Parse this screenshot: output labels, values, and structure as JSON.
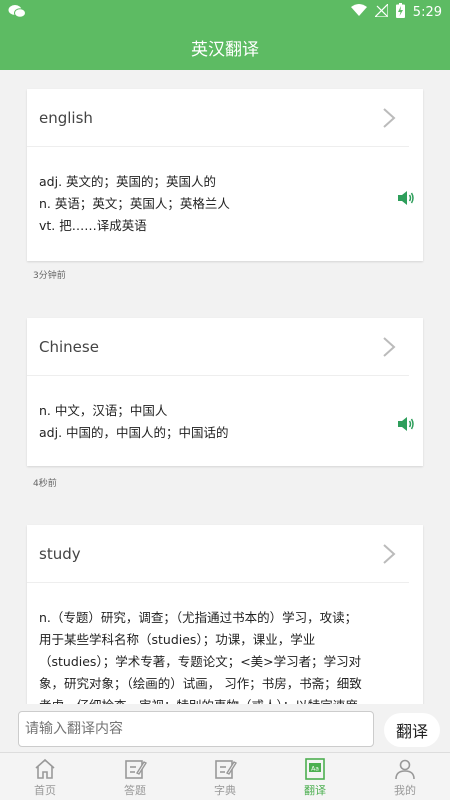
{
  "status": {
    "time": "5:29"
  },
  "header": {
    "title": "英汉翻译"
  },
  "history": [
    {
      "word": "english",
      "definitions": [
        "adj. 英文的；英国的；英国人的",
        "n. 英语；英文；英国人；英格兰人",
        "vt. 把……译成英语"
      ],
      "time": "3分钟前"
    },
    {
      "word": "Chinese",
      "definitions": [
        "n. 中文，汉语；中国人",
        "adj. 中国的，中国人的；中国话的"
      ],
      "time": "4秒前"
    },
    {
      "word": "study",
      "definitions": [
        "n.（专题）研究，调查；（尤指通过书本的）学习，攻读；",
        "用于某些学科名称（studies）；功课，课业，学业",
        "（studies）；学术专著，专题论文；<美>学习者；学习对",
        "象，研究对象；（绘画的）试画， 习作；书房，书斋；细致",
        "考虑，仔细检查，审视；特别的事物（或人）；以特定速度"
      ]
    }
  ],
  "input": {
    "placeholder": "请输入翻译内容",
    "button": "翻译"
  },
  "tabs": [
    {
      "label": "首页",
      "icon": "home-icon"
    },
    {
      "label": "答题",
      "icon": "quiz-icon"
    },
    {
      "label": "字典",
      "icon": "dictionary-icon"
    },
    {
      "label": "翻译",
      "icon": "translate-icon",
      "active": true
    },
    {
      "label": "我的",
      "icon": "profile-icon"
    }
  ],
  "colors": {
    "primary": "#5dbb63",
    "active_tab": "#4caf50",
    "speaker": "#2e9e5b"
  }
}
